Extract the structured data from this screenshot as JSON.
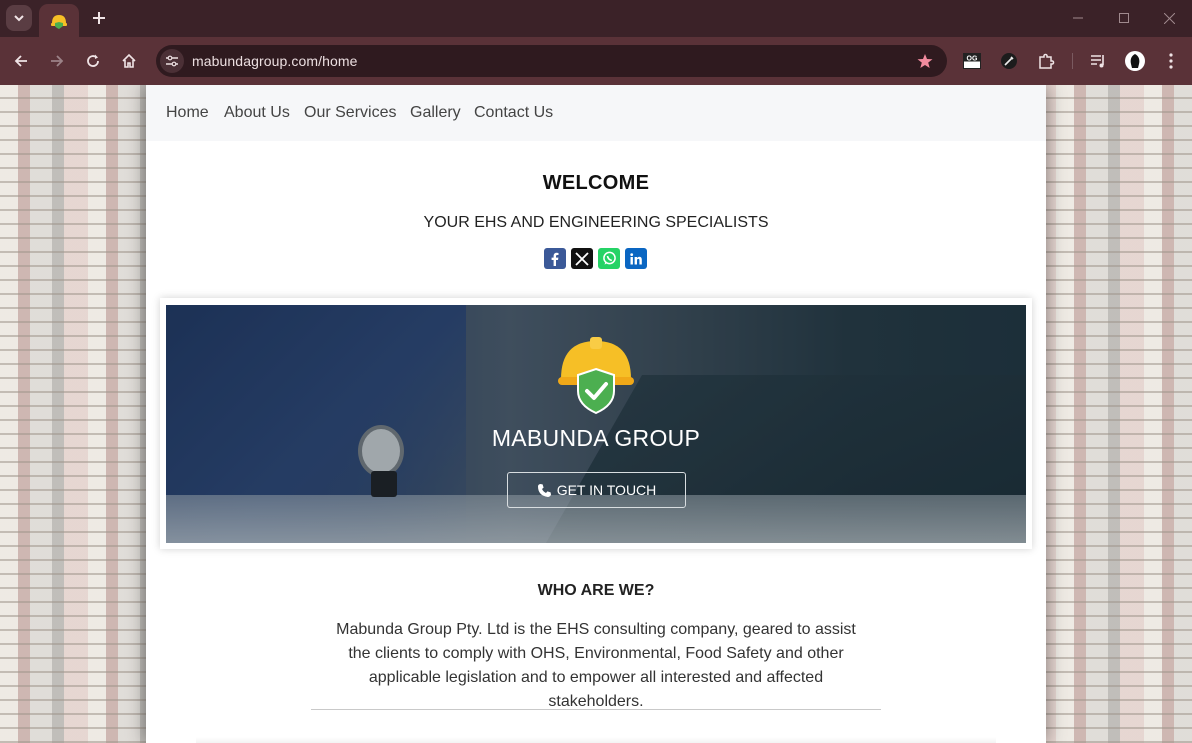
{
  "browser": {
    "url": "mabundagroup.com/home",
    "accent_color": "#5a3238",
    "star_color": "#f28b9e"
  },
  "nav": {
    "items": [
      "Home",
      "About Us",
      "Our Services",
      "Gallery",
      "Contact Us"
    ]
  },
  "welcome": {
    "title": "WELCOME",
    "tagline": "YOUR EHS AND ENGINEERING SPECIALISTS"
  },
  "share": {
    "icons": [
      "facebook-icon",
      "x-twitter-icon",
      "whatsapp-icon",
      "linkedin-icon"
    ],
    "colors": [
      "#3b5998",
      "#111111",
      "#25d366",
      "#0a66c2"
    ]
  },
  "hero": {
    "title": "MABUNDA GROUP",
    "cta_label": "GET IN TOUCH",
    "logo_icons": [
      "hardhat-icon",
      "shield-check-icon"
    ]
  },
  "about": {
    "heading": "WHO ARE WE?",
    "text": "Mabunda Group Pty. Ltd is the EHS consulting company, geared to assist the clients to comply with OHS, Environmental, Food Safety and other applicable legislation and to empower all interested and affected stakeholders."
  }
}
